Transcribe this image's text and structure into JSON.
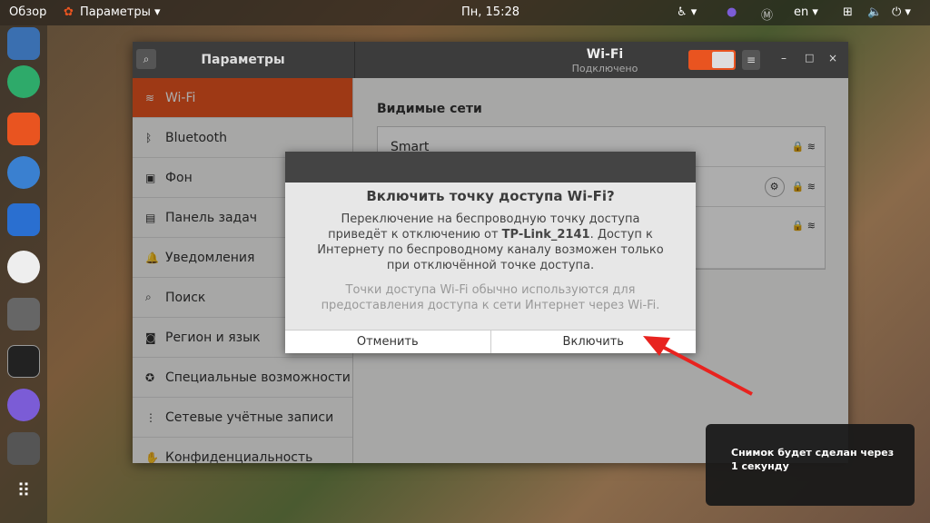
{
  "topbar": {
    "overview": "Обзор",
    "app": "Параметры",
    "clock": "Пн, 15:28",
    "lang": "en"
  },
  "window": {
    "sidebar_title": "Параметры",
    "title": "Wi-Fi",
    "subtitle": "Подключено"
  },
  "sidebar": {
    "items": [
      {
        "label": "Wi-Fi",
        "icon": "wifi-icon"
      },
      {
        "label": "Bluetooth",
        "icon": "bluetooth-icon"
      },
      {
        "label": "Фон",
        "icon": "background-icon"
      },
      {
        "label": "Панель задач",
        "icon": "dock-icon"
      },
      {
        "label": "Уведомления",
        "icon": "bell-icon"
      },
      {
        "label": "Поиск",
        "icon": "search-icon"
      },
      {
        "label": "Регион и язык",
        "icon": "camera-icon"
      },
      {
        "label": "Специальные возможности",
        "icon": "accessibility-icon"
      },
      {
        "label": "Сетевые учётные записи",
        "icon": "accounts-icon"
      },
      {
        "label": "Конфиденциальность",
        "icon": "privacy-icon"
      }
    ]
  },
  "main": {
    "visible_networks": "Видимые сети",
    "networks": [
      {
        "name": "Smart"
      },
      {
        "name": ""
      },
      {
        "name": ""
      }
    ]
  },
  "dialog": {
    "title": "Включить точку доступа Wi-Fi?",
    "text_1": "Переключение на беспроводную точку доступа приведёт к отключению от ",
    "network": "TP-Link_2141",
    "text_2": ". Доступ к Интернету по беспроводному каналу возможен только при отключённой точке доступа.",
    "secondary": "Точки доступа Wi-Fi обычно используются для предоставления доступа к сети Интернет через Wi-Fi.",
    "cancel": "Отменить",
    "confirm": "Включить"
  },
  "notification": {
    "text": "Снимок будет сделан через 1 секунду"
  },
  "colors": {
    "accent": "#e95420",
    "arrow": "#e8231f"
  }
}
